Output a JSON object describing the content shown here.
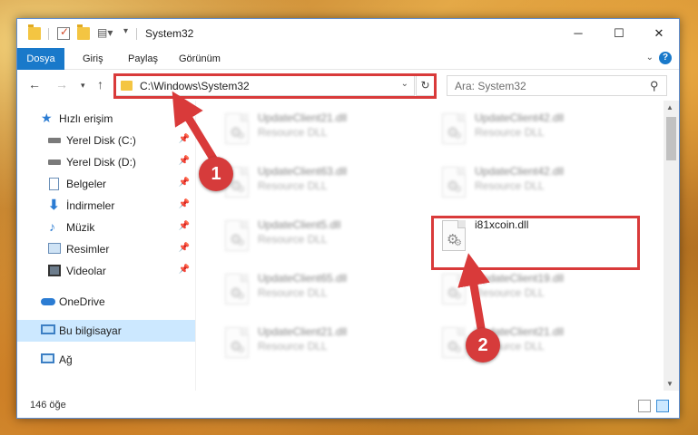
{
  "window": {
    "title": "System32",
    "controls": {
      "minimize": "─",
      "maximize": "☐",
      "close": "✕"
    }
  },
  "ribbon": {
    "tabs": [
      "Dosya",
      "Giriş",
      "Paylaş",
      "Görünüm"
    ],
    "help": "?"
  },
  "navigation": {
    "address": "C:\\Windows\\System32",
    "search_placeholder": "Ara: System32"
  },
  "sidebar": {
    "quick_access": "Hızlı erişim",
    "pinned": [
      "Yerel Disk (C:)",
      "Yerel Disk (D:)",
      "Belgeler",
      "İndirmeler",
      "Müzik",
      "Resimler",
      "Videolar"
    ],
    "onedrive": "OneDrive",
    "this_pc": "Bu bilgisayar",
    "network": "Ağ"
  },
  "files": [
    {
      "name": "UpdateClient21.dll",
      "type": "Resource DLL"
    },
    {
      "name": "UpdateClient42.dll",
      "type": "Resource DLL"
    },
    {
      "name": "UpdateClient63.dll",
      "type": "Resource DLL"
    },
    {
      "name": "UpdateClient42.dll",
      "type": "Resource DLL"
    },
    {
      "name": "UpdateClient5.dll",
      "type": "Resource DLL"
    },
    {
      "name": "i81xcoin.dll",
      "type": ""
    },
    {
      "name": "UpdateClient65.dll",
      "type": "Resource DLL"
    },
    {
      "name": "UpdateClient19.dll",
      "type": "Resource DLL"
    },
    {
      "name": "UpdateClient21.dll",
      "type": "Resource DLL"
    },
    {
      "name": "UpdateClient21.dll",
      "type": "Resource DLL"
    }
  ],
  "status": {
    "item_count": "146 öğe"
  },
  "annotations": {
    "step1": "1",
    "step2": "2",
    "color": "#d93a3a"
  }
}
